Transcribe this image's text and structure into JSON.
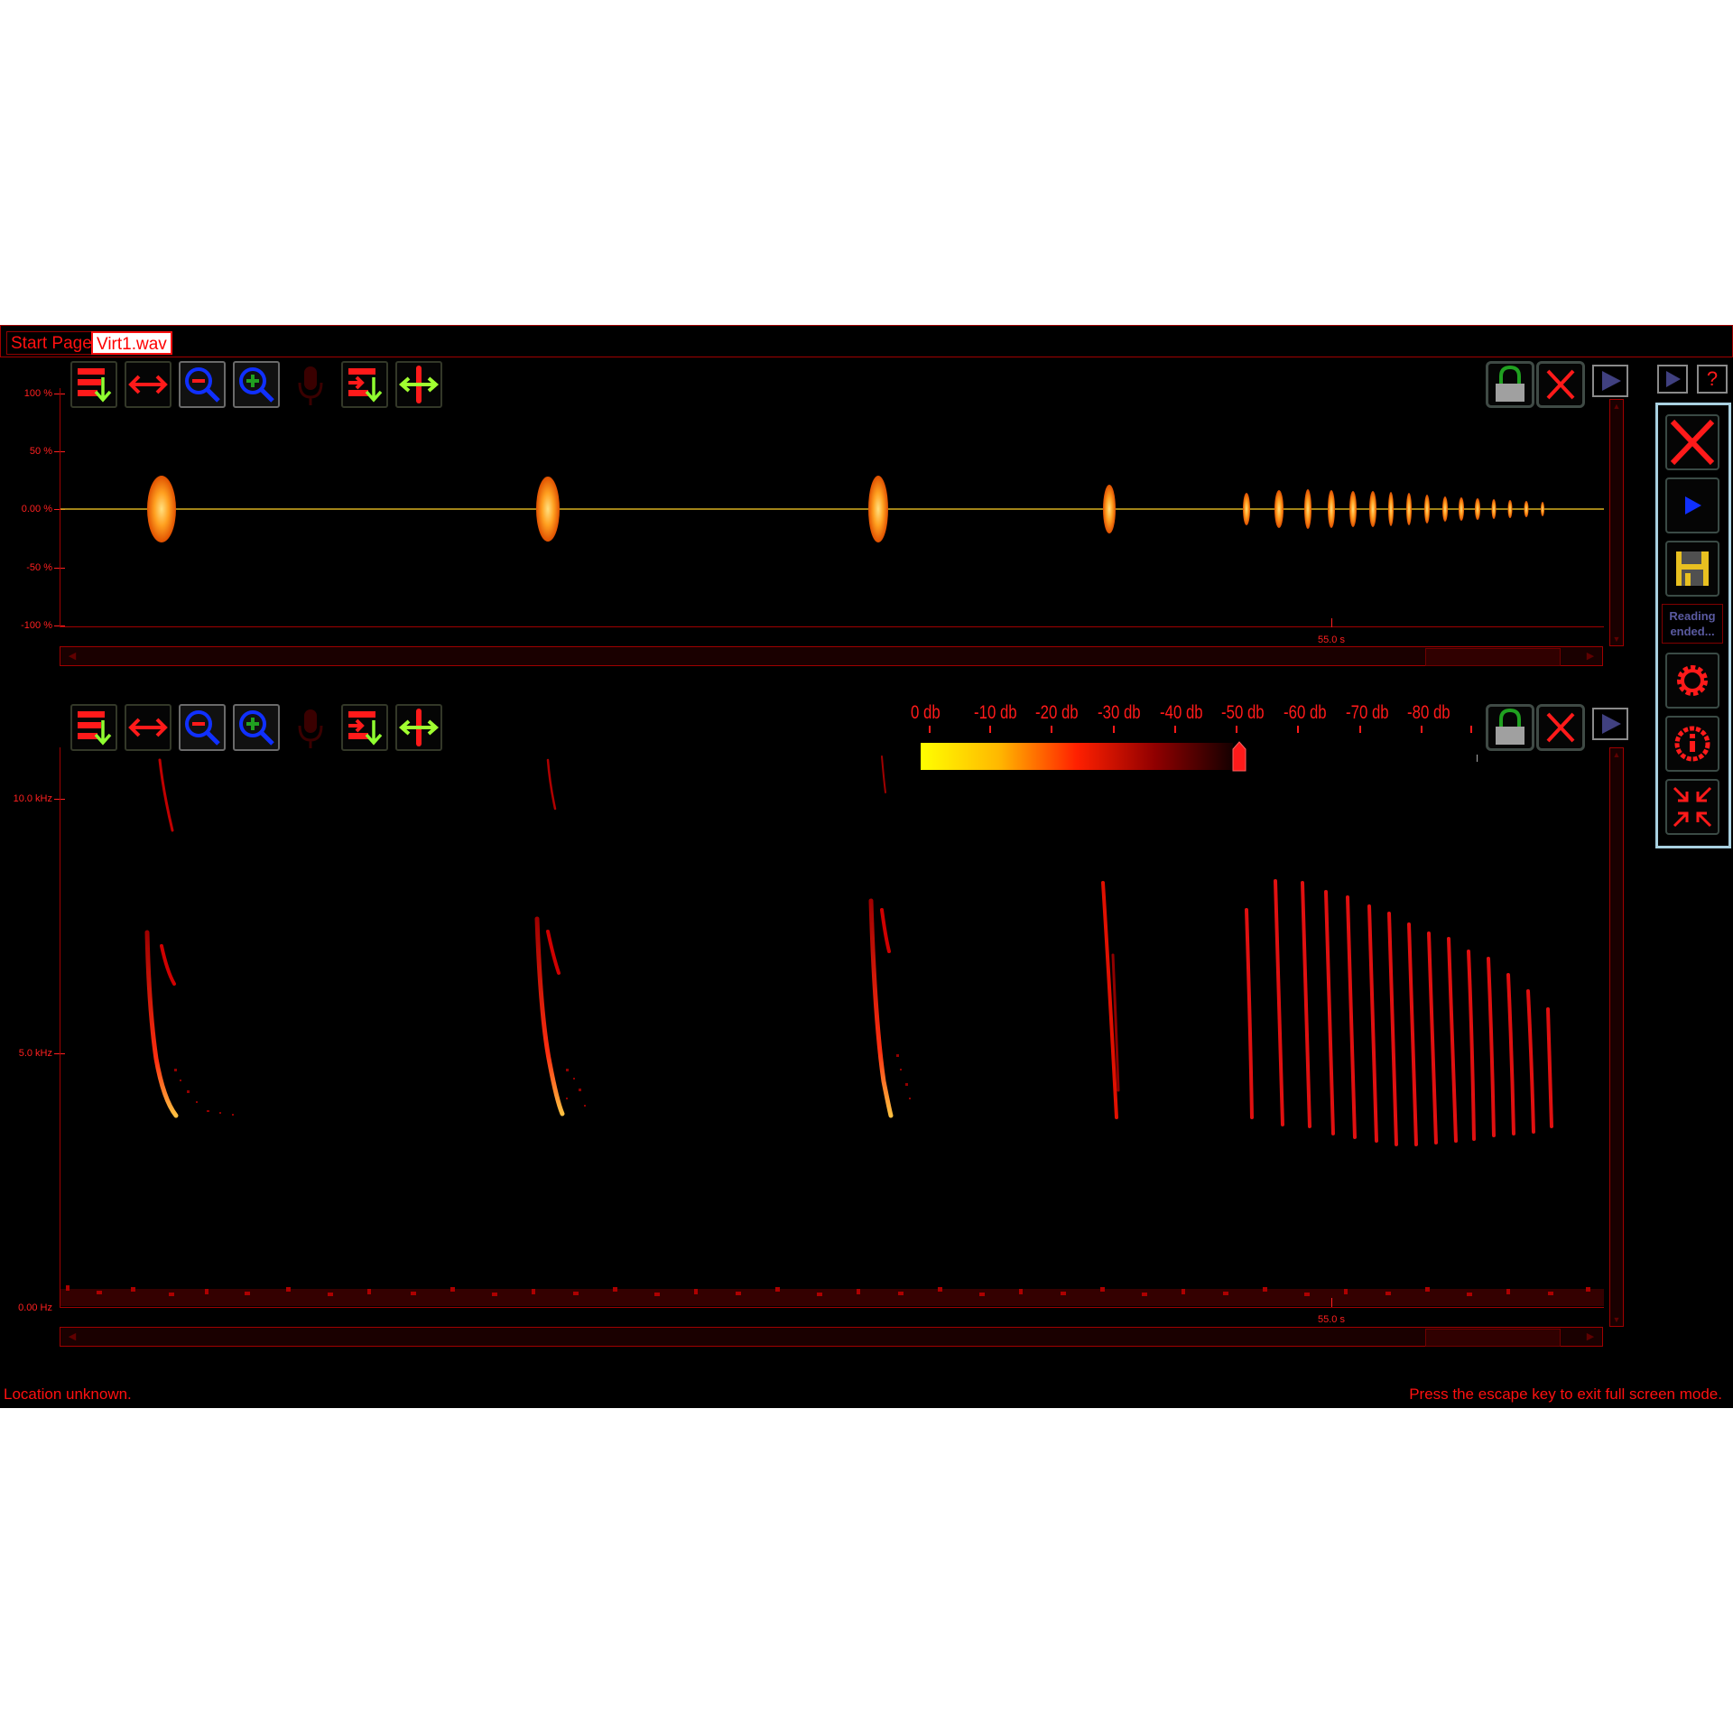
{
  "tabs": [
    {
      "label": "Start Page",
      "active": false
    },
    {
      "label": "Virt1.wav",
      "active": true
    }
  ],
  "waveform": {
    "y_ticks": [
      "100 %",
      "50 %",
      "0.00 %",
      "-50 %",
      "-100 %"
    ],
    "time_marker": "55.0 s"
  },
  "spectrogram": {
    "y_ticks": [
      "10.0 kHz",
      "5.0 kHz",
      "0.00 Hz"
    ],
    "time_marker": "55.0 s",
    "db_scale": [
      "0 db",
      "-10 db",
      "-20 db",
      "-30 db",
      "-40 db",
      "-50 db",
      "-60 db",
      "-70 db",
      "-80 db"
    ],
    "threshold_db": -52
  },
  "side_panel": {
    "status_text": "Reading ended..."
  },
  "top_right": {
    "help_label": "?"
  },
  "status_left": "Location unknown.",
  "status_right": "Press the escape key to exit full screen mode.",
  "colors": {
    "accent": "#ff1010",
    "background": "#000000",
    "wave": "#ffd040",
    "zoom_blue": "#1030ff",
    "arrow_green": "#90ff30"
  },
  "icons": {
    "toolbar": [
      "menu-down-icon",
      "fit-width-icon",
      "zoom-out-icon",
      "zoom-in-icon",
      "microphone-icon",
      "insert-icon",
      "move-icon"
    ],
    "right": [
      "lock-icon",
      "close-icon",
      "play-icon"
    ],
    "side": [
      "close-icon",
      "play-icon",
      "save-icon",
      "settings-icon",
      "info-icon",
      "exit-fullscreen-icon"
    ]
  }
}
